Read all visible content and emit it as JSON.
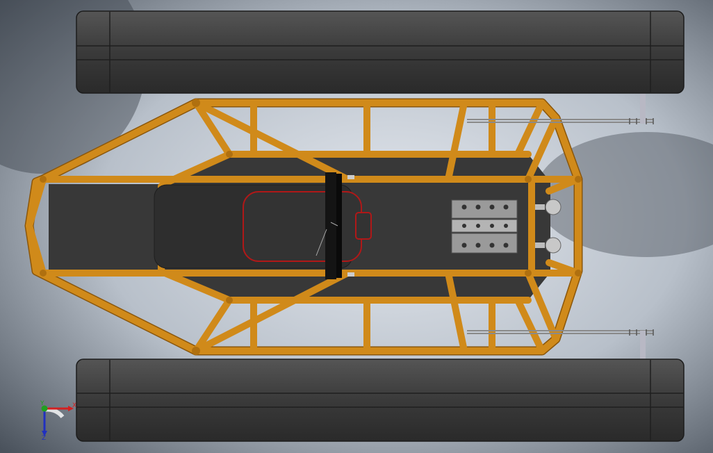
{
  "viewport": {
    "background": {
      "light": "#e4e8ee",
      "mid": "#b8c0ca",
      "dark": "#4a525c"
    }
  },
  "model": {
    "frame_color": "#d08a1a",
    "frame_shadow": "#8a560b",
    "track_color": "#3e3e3e",
    "floor_color": "#383838",
    "seat_outline": "#b01818",
    "engine_color": "#9a9a9a"
  },
  "triad": {
    "x_label": "X",
    "y_label": "Y",
    "z_label": "Z",
    "x_color": "#d42020",
    "y_color": "#20a020",
    "z_color": "#2030c0"
  }
}
